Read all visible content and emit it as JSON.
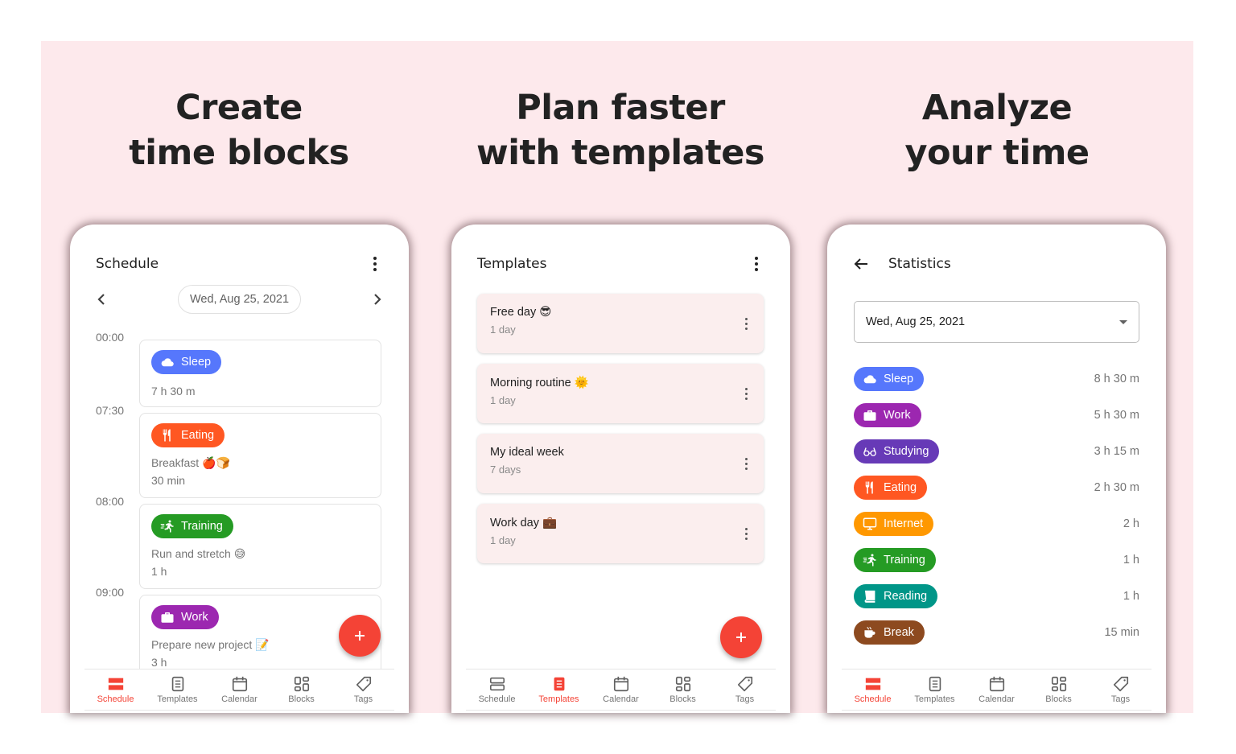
{
  "panels": [
    {
      "headline": [
        "Create",
        "time blocks"
      ],
      "screen": {
        "title": "Schedule",
        "date": "Wed, Aug 25, 2021",
        "blocks": [
          {
            "time": "00:00",
            "tag": "Sleep",
            "color": "#5677fc",
            "icon": "cloud-icon",
            "desc": "",
            "duration": "7 h 30 m"
          },
          {
            "time": "07:30",
            "tag": "Eating",
            "color": "#ff5722",
            "icon": "fork-knife-icon",
            "desc": "Breakfast 🍎🍞",
            "duration": "30 min"
          },
          {
            "time": "08:00",
            "tag": "Training",
            "color": "#259b24",
            "icon": "running-icon",
            "desc": "Run and stretch 😅",
            "duration": "1 h"
          },
          {
            "time": "09:00",
            "tag": "Work",
            "color": "#9c27b0",
            "icon": "briefcase-icon",
            "desc": "Prepare new project 📝",
            "duration": "3 h"
          }
        ],
        "active_nav": "Schedule"
      }
    },
    {
      "headline": [
        "Plan faster",
        "with templates"
      ],
      "screen": {
        "title": "Templates",
        "templates": [
          {
            "name": "Free day 😎",
            "length": "1 day"
          },
          {
            "name": "Morning routine 🌞",
            "length": "1 day"
          },
          {
            "name": "My ideal week",
            "length": "7 days"
          },
          {
            "name": "Work day 💼",
            "length": "1 day"
          }
        ],
        "active_nav": "Templates"
      }
    },
    {
      "headline": [
        "Analyze",
        "your time"
      ],
      "screen": {
        "title": "Statistics",
        "date": "Wed, Aug 25, 2021",
        "stats": [
          {
            "tag": "Sleep",
            "color": "#5677fc",
            "icon": "cloud-icon",
            "duration": "8 h 30 m"
          },
          {
            "tag": "Work",
            "color": "#9c27b0",
            "icon": "briefcase-icon",
            "duration": "5 h 30 m"
          },
          {
            "tag": "Studying",
            "color": "#673ab7",
            "icon": "glasses-icon",
            "duration": "3 h 15 m"
          },
          {
            "tag": "Eating",
            "color": "#ff5722",
            "icon": "fork-knife-icon",
            "duration": "2 h 30 m"
          },
          {
            "tag": "Internet",
            "color": "#ff9800",
            "icon": "monitor-icon",
            "duration": "2 h"
          },
          {
            "tag": "Training",
            "color": "#259b24",
            "icon": "running-icon",
            "duration": "1 h"
          },
          {
            "tag": "Reading",
            "color": "#009688",
            "icon": "book-icon",
            "duration": "1 h"
          },
          {
            "tag": "Break",
            "color": "#8d4a1f",
            "icon": "coffee-icon",
            "duration": "15 min"
          }
        ],
        "active_nav": "Schedule"
      }
    }
  ],
  "nav": [
    "Schedule",
    "Templates",
    "Calendar",
    "Blocks",
    "Tags"
  ],
  "colors": {
    "accent": "#f44336",
    "background": "#fde9ec"
  }
}
